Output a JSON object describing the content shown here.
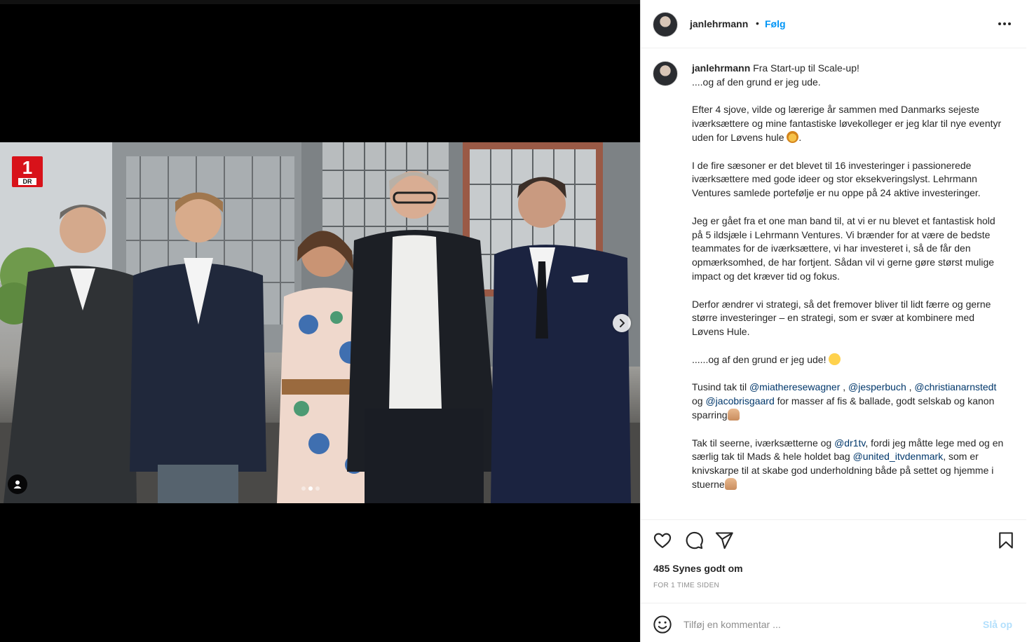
{
  "media": {
    "overlay_logo": {
      "number": "1",
      "label": "DR",
      "color": "#d8121a"
    },
    "carousel": {
      "slide_count": 3,
      "active_index": 1
    },
    "next_button_icon": "chevron-right-icon",
    "tag_button_icon": "user-tag-icon"
  },
  "post_header": {
    "username": "janlehrmann",
    "separator": "•",
    "follow_label": "Følg",
    "more_icon": "more-horizontal-icon"
  },
  "caption": {
    "username": "janlehrmann",
    "paragraphs": {
      "p1_line1": "Fra Start-up til Scale-up!",
      "p1_line2": "....og af den grund er jeg ude.",
      "p2": "Efter 4 sjove, vilde og lærerige år sammen med Danmarks sejeste iværksættere og mine fantastiske løvekolleger er jeg klar til nye eventyr uden for Løvens hule",
      "p2_end": ".",
      "p3": "I de fire sæsoner er det blevet til 16 investeringer i passionerede iværksættere med gode ideer og stor eksekveringslyst. Lehrmann Ventures samlede portefølje er nu oppe på 24 aktive investeringer.",
      "p4": "Jeg er gået fra et one man band til, at vi er nu blevet et fantastisk hold på 5 ildsjæle i Lehrmann Ventures. Vi brænder for at være de bedste teammates for de iværksættere, vi har investeret i, så de får den opmærksomhed, de har fortjent. Sådan vil vi gerne gøre størst mulige impact og det kræver tid og fokus.",
      "p5": "Derfor ændrer vi strategi, så det fremover bliver til lidt færre og gerne større investeringer – en strategi, som er svær at kombinere med Løvens Hule.",
      "p6": "......og af den grund er jeg ude!",
      "p7_start": "Tusind tak til",
      "p7_m1": "@miatheresewagner",
      "p7_c1": ",",
      "p7_m2": "@jesperbuch",
      "p7_c2": ",",
      "p7_m3": "@christianarnstedt",
      "p7_og": "og",
      "p7_m4": "@jacobrisgaard",
      "p7_end": "for masser af fis & ballade, godt selskab og kanon sparring",
      "p8_start": "Tak til seerne, iværksætterne og",
      "p8_m1": "@dr1tv",
      "p8_mid": ", fordi jeg måtte lege med og en særlig tak til Mads & hele holdet bag",
      "p8_m2": "@united_itvdenmark",
      "p8_end": ", som er knivskarpe til at skabe god underholdning både på settet og hjemme i stuerne"
    }
  },
  "actions": {
    "like_icon": "heart-icon",
    "comment_icon": "comment-icon",
    "share_icon": "paper-plane-icon",
    "save_icon": "bookmark-icon"
  },
  "likes_text": "485 Synes godt om",
  "timestamp": "FOR 1 TIME SIDEN",
  "comment_box": {
    "emoji_icon": "smiley-icon",
    "placeholder": "Tilføj en kommentar ...",
    "post_label": "Slå op"
  },
  "colors": {
    "link_blue": "#0095f6",
    "mention_blue": "#00376b",
    "post_disabled": "#b2dffc",
    "muted_text": "#8e8e8e"
  }
}
